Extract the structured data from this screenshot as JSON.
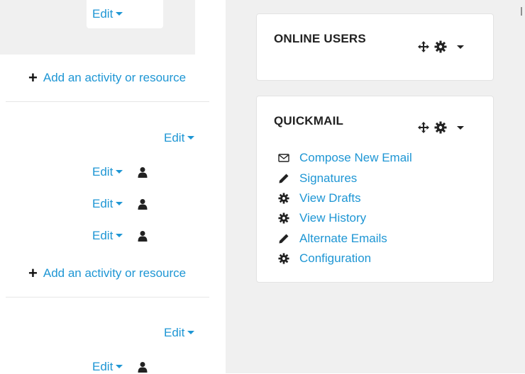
{
  "course_sections": {
    "top_edit_label": "Edit",
    "add_activity_label_1": "Add an activity or resource",
    "section_edit_label": "Edit",
    "activity_edits": [
      {
        "label": "Edit"
      },
      {
        "label": "Edit"
      },
      {
        "label": "Edit"
      }
    ],
    "add_activity_label_2": "Add an activity or resource",
    "section2_edit_label": "Edit",
    "section2_activity_edit_label": "Edit"
  },
  "blocks": {
    "online_users": {
      "title": "ONLINE USERS"
    },
    "quickmail": {
      "title": "QUICKMAIL",
      "items": [
        {
          "label": "Compose New Email",
          "icon": "envelope-icon"
        },
        {
          "label": "Signatures",
          "icon": "pencil-icon"
        },
        {
          "label": "View Drafts",
          "icon": "gear-icon"
        },
        {
          "label": "View History",
          "icon": "gear-icon"
        },
        {
          "label": "Alternate Emails",
          "icon": "pencil-icon"
        },
        {
          "label": "Configuration",
          "icon": "gear-icon"
        }
      ]
    }
  },
  "colors": {
    "link": "#1e96d4",
    "panel_bg": "#f0f0f0"
  }
}
